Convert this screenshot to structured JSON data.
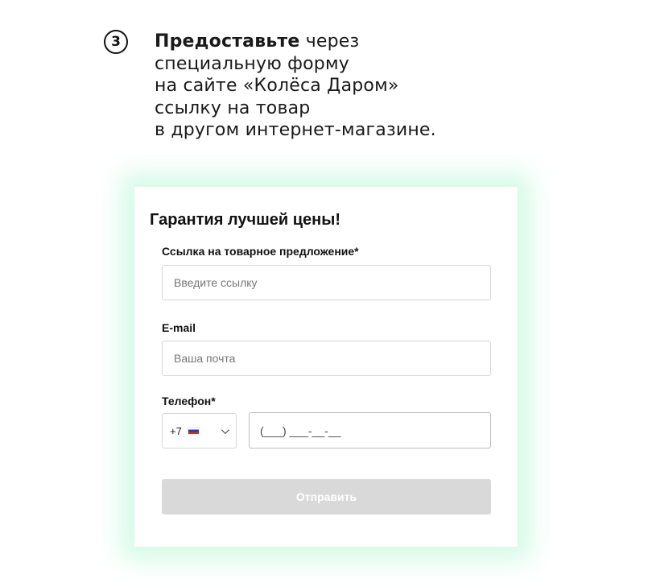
{
  "step": {
    "number": "3",
    "text_bold": "Предоставьте",
    "text_line1_rest": " через",
    "text_line2": "специальную форму",
    "text_line3": "на сайте «Колёса Даром»",
    "text_line4": "ссылку на товар",
    "text_line5": "в другом интернет-магазине."
  },
  "form": {
    "title": "Гарантия лучшей цены!",
    "link_field": {
      "label": "Ссылка на товарное предложение*",
      "placeholder": "Введите ссылку"
    },
    "email_field": {
      "label": "E-mail",
      "placeholder": "Ваша почта"
    },
    "phone_field": {
      "label": "Телефон*",
      "country_code": "+7",
      "country_flag": "flag-ru-icon",
      "placeholder": "(___) ___-__-__"
    },
    "submit_label": "Отправить"
  },
  "colors": {
    "card_glow": "#a0f5c8",
    "button_disabled_bg": "#d9d9d9",
    "input_border": "#d7d7d7"
  }
}
